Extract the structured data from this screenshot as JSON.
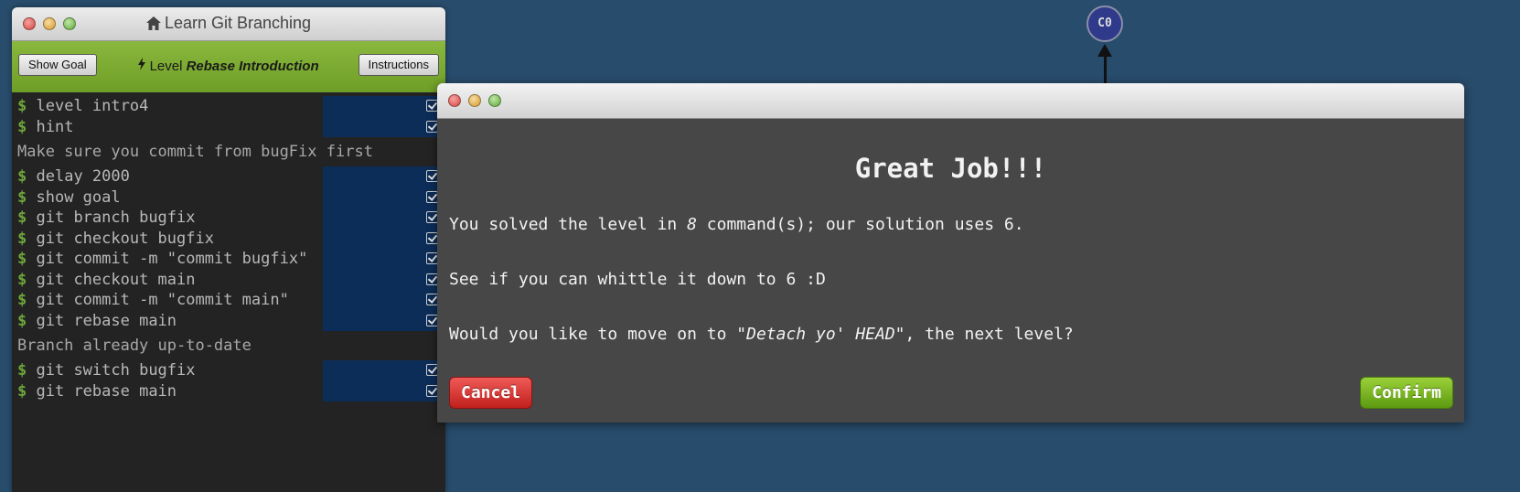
{
  "terminal": {
    "title": "Learn Git Branching",
    "show_goal_label": "Show Goal",
    "instructions_label": "Instructions",
    "level_prefix": "Level",
    "level_name": "Rebase Introduction",
    "history": [
      {
        "kind": "cmd",
        "text": "level intro4"
      },
      {
        "kind": "cmd",
        "text": "hint"
      },
      {
        "kind": "msg",
        "text": "Make sure you commit from bugFix first"
      },
      {
        "kind": "cmd",
        "text": "delay 2000"
      },
      {
        "kind": "cmd",
        "text": "show goal"
      },
      {
        "kind": "cmd",
        "text": "git branch bugfix"
      },
      {
        "kind": "cmd",
        "text": "git checkout bugfix"
      },
      {
        "kind": "cmd",
        "text": "git commit -m \"commit bugfix\""
      },
      {
        "kind": "cmd",
        "text": "git checkout main"
      },
      {
        "kind": "cmd",
        "text": "git commit -m \"commit main\""
      },
      {
        "kind": "cmd",
        "text": "git rebase main"
      },
      {
        "kind": "msg",
        "text": "Branch already up-to-date"
      },
      {
        "kind": "cmd",
        "text": "git switch bugfix"
      },
      {
        "kind": "cmd",
        "text": "git rebase main"
      }
    ],
    "prompt_symbol": "$"
  },
  "graph": {
    "commit_label": "C0"
  },
  "modal": {
    "heading": "Great Job!!!",
    "line1_a": "You solved the level in ",
    "line1_count": "8",
    "line1_b": " command(s); our solution uses 6.",
    "line2": "See if you can whittle it down to 6 :D",
    "line3_a": "Would you like to move on to ",
    "line3_level": "\"Detach yo' HEAD\"",
    "line3_b": ", the next level?",
    "cancel_label": "Cancel",
    "confirm_label": "Confirm"
  },
  "colors": {
    "background": "#284c6b",
    "level_bar": "#7aa832",
    "cancel": "#d63a36",
    "confirm": "#7ab528"
  }
}
